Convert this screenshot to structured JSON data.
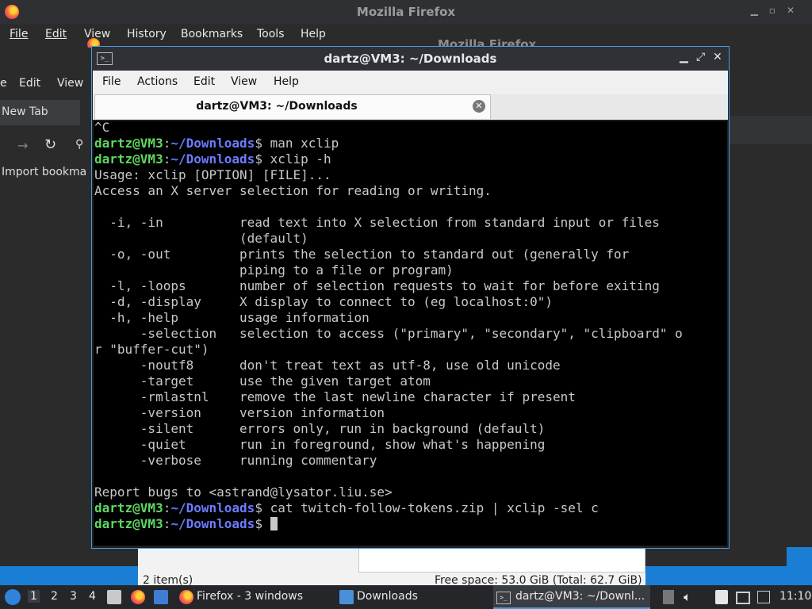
{
  "firefox": {
    "title": "Mozilla Firefox",
    "menu": [
      "File",
      "Edit",
      "View",
      "History",
      "Bookmarks",
      "Tools",
      "Help"
    ],
    "menu2": [
      "e",
      "Edit",
      "View"
    ],
    "tab": "New Tab",
    "bookmark": "Import bookma",
    "second_title": "Mozilla Firefox"
  },
  "file_manager": {
    "items": "2 item(s)",
    "free_space": "Free space: 53.0 GiB (Total: 62.7 GiB)"
  },
  "terminal": {
    "title": "dartz@VM3: ~/Downloads",
    "menu": [
      "File",
      "Actions",
      "Edit",
      "View",
      "Help"
    ],
    "tab_label": "dartz@VM3: ~/Downloads",
    "prompt_user": "dartz@VM3",
    "prompt_path": "~/Downloads",
    "lines": [
      {
        "type": "text",
        "text": "^C"
      },
      {
        "type": "prompt",
        "text": "man xclip"
      },
      {
        "type": "prompt",
        "text": "xclip -h"
      },
      {
        "type": "text",
        "text": "Usage: xclip [OPTION] [FILE]..."
      },
      {
        "type": "text",
        "text": "Access an X server selection for reading or writing."
      },
      {
        "type": "text",
        "text": ""
      },
      {
        "type": "text",
        "text": "  -i, -in          read text into X selection from standard input or files"
      },
      {
        "type": "text",
        "text": "                   (default)"
      },
      {
        "type": "text",
        "text": "  -o, -out         prints the selection to standard out (generally for"
      },
      {
        "type": "text",
        "text": "                   piping to a file or program)"
      },
      {
        "type": "text",
        "text": "  -l, -loops       number of selection requests to wait for before exiting"
      },
      {
        "type": "text",
        "text": "  -d, -display     X display to connect to (eg localhost:0\")"
      },
      {
        "type": "text",
        "text": "  -h, -help        usage information"
      },
      {
        "type": "text",
        "text": "      -selection   selection to access (\"primary\", \"secondary\", \"clipboard\" o"
      },
      {
        "type": "text",
        "text": "r \"buffer-cut\")"
      },
      {
        "type": "text",
        "text": "      -noutf8      don't treat text as utf-8, use old unicode"
      },
      {
        "type": "text",
        "text": "      -target      use the given target atom"
      },
      {
        "type": "text",
        "text": "      -rmlastnl    remove the last newline character if present"
      },
      {
        "type": "text",
        "text": "      -version     version information"
      },
      {
        "type": "text",
        "text": "      -silent      errors only, run in background (default)"
      },
      {
        "type": "text",
        "text": "      -quiet       run in foreground, show what's happening"
      },
      {
        "type": "text",
        "text": "      -verbose     running commentary"
      },
      {
        "type": "text",
        "text": ""
      },
      {
        "type": "text",
        "text": "Report bugs to <astrand@lysator.liu.se>"
      },
      {
        "type": "prompt",
        "text": "cat twitch-follow-tokens.zip | xclip -sel c"
      },
      {
        "type": "prompt",
        "text": "",
        "cursor": true
      }
    ]
  },
  "taskbar": {
    "workspaces": [
      "1",
      "2",
      "3",
      "4"
    ],
    "firefox_label": "Firefox - 3 windows",
    "downloads_label": "Downloads",
    "terminal_label": "dartz@VM3: ~/Downl...",
    "clock": "11:10"
  },
  "colors": {
    "prompt_user": "#5fd75f",
    "prompt_path": "#6b7cff",
    "accent": "#1a7fd4"
  }
}
